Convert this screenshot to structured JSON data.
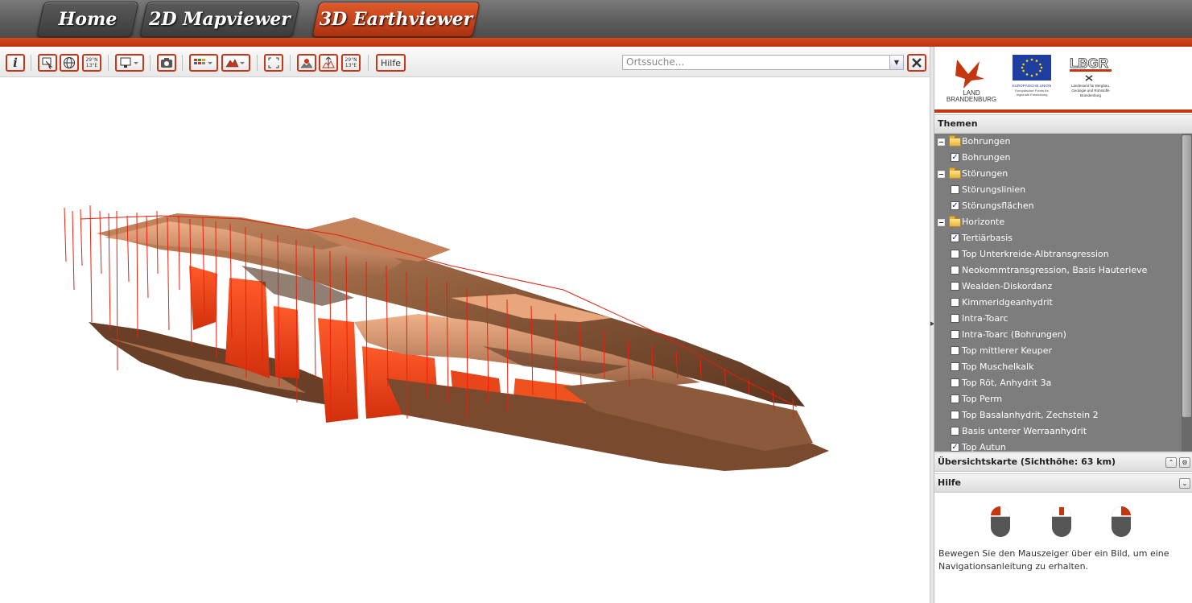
{
  "nav": {
    "tabs": [
      {
        "label": "Home"
      },
      {
        "label": "2D Mapviewer"
      },
      {
        "label": "3D Earthviewer"
      }
    ],
    "active_tab": "3D Earthviewer",
    "accent_color": "#c4360f"
  },
  "toolbar": {
    "coord_label_1": "29°N\n13°E",
    "coord_label_2": "29°N\n13°E",
    "help_label": "Hilfe",
    "search_placeholder": "Ortssuche..."
  },
  "logos": {
    "brandenburg": "LAND\nBRANDENBURG",
    "eu_title": "EUROPÄISCHE UNION",
    "eu_sub": "Europäischer Fonds für regionale Entwicklung",
    "lbgr_abbr": "LBGR",
    "lbgr_name": "Landesamt für Bergbau, Geologie und Rohstoffe Brandenburg"
  },
  "themen": {
    "title": "Themen",
    "items": [
      {
        "type": "folder",
        "label": "Bohrungen"
      },
      {
        "type": "layer",
        "label": "Bohrungen",
        "checked": true
      },
      {
        "type": "folder",
        "label": "Störungen"
      },
      {
        "type": "layer",
        "label": "Störungslinien",
        "checked": false
      },
      {
        "type": "layer",
        "label": "Störungsflächen",
        "checked": true
      },
      {
        "type": "folder",
        "label": "Horizonte"
      },
      {
        "type": "layer",
        "label": "Tertiärbasis",
        "checked": true
      },
      {
        "type": "layer",
        "label": "Top Unterkreide-Albtransgression",
        "checked": false
      },
      {
        "type": "layer",
        "label": "Neokommtransgression, Basis Hauterieve",
        "checked": false
      },
      {
        "type": "layer",
        "label": "Wealden-Diskordanz",
        "checked": false
      },
      {
        "type": "layer",
        "label": "Kimmeridgeanhydrit",
        "checked": false
      },
      {
        "type": "layer",
        "label": "Intra-Toarc",
        "checked": false
      },
      {
        "type": "layer",
        "label": "Intra-Toarc (Bohrungen)",
        "checked": false
      },
      {
        "type": "layer",
        "label": "Top mittlerer Keuper",
        "checked": false
      },
      {
        "type": "layer",
        "label": "Top Muschelkalk",
        "checked": false
      },
      {
        "type": "layer",
        "label": "Top Röt, Anhydrit 3a",
        "checked": false
      },
      {
        "type": "layer",
        "label": "Top Perm",
        "checked": false
      },
      {
        "type": "layer",
        "label": "Top Basalanhydrit, Zechstein 2",
        "checked": false
      },
      {
        "type": "layer",
        "label": "Basis unterer Werraanhydrit",
        "checked": false
      },
      {
        "type": "layer",
        "label": "Top Autun",
        "checked": true
      }
    ]
  },
  "overview": {
    "title": "Übersichtskarte (Sichthöhe: 63 km)"
  },
  "help": {
    "title": "Hilfe",
    "text": "Bewegen Sie den Mauszeiger über ein Bild, um eine Navigationsanleitung zu erhalten."
  }
}
